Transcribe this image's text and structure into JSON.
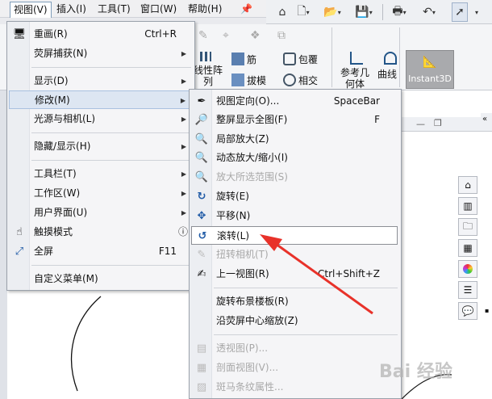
{
  "menubar": {
    "items": [
      {
        "label": "视图(V)",
        "active": true
      },
      {
        "label": "插入(I)"
      },
      {
        "label": "工具(T)"
      },
      {
        "label": "窗口(W)"
      },
      {
        "label": "帮助(H)"
      }
    ],
    "pin_icon": "pin-icon"
  },
  "quickbar": {
    "icons": [
      "home-icon",
      "new-doc-icon",
      "open-icon",
      "save-icon",
      "print-icon",
      "undo-icon",
      "select-arrow-icon"
    ]
  },
  "cmdbar": {
    "feature1_label": "筋",
    "feature2_label": "拔模",
    "feature3_label": "包覆",
    "feature4_label": "相交",
    "linear_pattern_label_line1": "线性阵",
    "linear_pattern_label_line2": "列",
    "ref_geometry_line1": "参考几",
    "ref_geometry_line2": "何体",
    "curves_label": "曲线",
    "instant3d_label": "Instant3D"
  },
  "view_menu": {
    "items": [
      {
        "icon": "redraw-icon",
        "label": "重画(R)",
        "shortcut": "Ctrl+R"
      },
      {
        "label": "荧屏捕获(N)",
        "submenu": true
      },
      {
        "label": "显示(D)",
        "submenu": true
      },
      {
        "label": "修改(M)",
        "submenu": true,
        "highlighted": true
      },
      {
        "label": "光源与相机(L)",
        "submenu": true
      },
      {
        "label": "隐藏/显示(H)",
        "submenu": true
      },
      {
        "label": "工具栏(T)",
        "submenu": true
      },
      {
        "label": "工作区(W)",
        "submenu": true
      },
      {
        "label": "用户界面(U)",
        "submenu": true
      },
      {
        "icon": "touch-icon",
        "label": "触摸模式",
        "help_icon": "help-icon"
      },
      {
        "icon": "fullscreen-icon",
        "label": "全屏",
        "shortcut": "F11"
      },
      {
        "label": "自定义菜单(M)"
      }
    ]
  },
  "modify_menu": {
    "items": [
      {
        "icon": "view-orientation-icon",
        "label": "视图定向(O)...",
        "shortcut": "SpaceBar"
      },
      {
        "icon": "zoom-to-fit-icon",
        "label": "整屏显示全图(F)",
        "shortcut": "F"
      },
      {
        "icon": "zoom-to-area-icon",
        "label": "局部放大(Z)"
      },
      {
        "icon": "zoom-in-out-icon",
        "label": "动态放大/缩小(I)"
      },
      {
        "icon": "zoom-to-selection-icon",
        "label": "放大所选范围(S)",
        "disabled": true
      },
      {
        "icon": "rotate-icon",
        "label": "旋转(E)"
      },
      {
        "icon": "pan-icon",
        "label": "平移(N)"
      },
      {
        "icon": "roll-icon",
        "label": "滚转(L)",
        "boxed": true
      },
      {
        "icon": "turn-camera-icon",
        "label": "扭转相机(T)",
        "disabled": true
      },
      {
        "icon": "previous-view-icon",
        "label": "上一视图(R)",
        "shortcut": "Ctrl+Shift+Z"
      },
      {
        "label": "旋转布景楼板(R)"
      },
      {
        "label": "沿荧屏中心缩放(Z)"
      },
      {
        "icon": "perspective-icon",
        "label": "透视图(P)...",
        "disabled": true
      },
      {
        "icon": "section-view-icon",
        "label": "剖面视图(V)...",
        "disabled": true
      },
      {
        "icon": "zebra-stripes-icon",
        "label": "斑马条纹属性...",
        "disabled": true
      }
    ]
  },
  "watermark": "Bai 经验",
  "annotation_color": "#e8322a"
}
